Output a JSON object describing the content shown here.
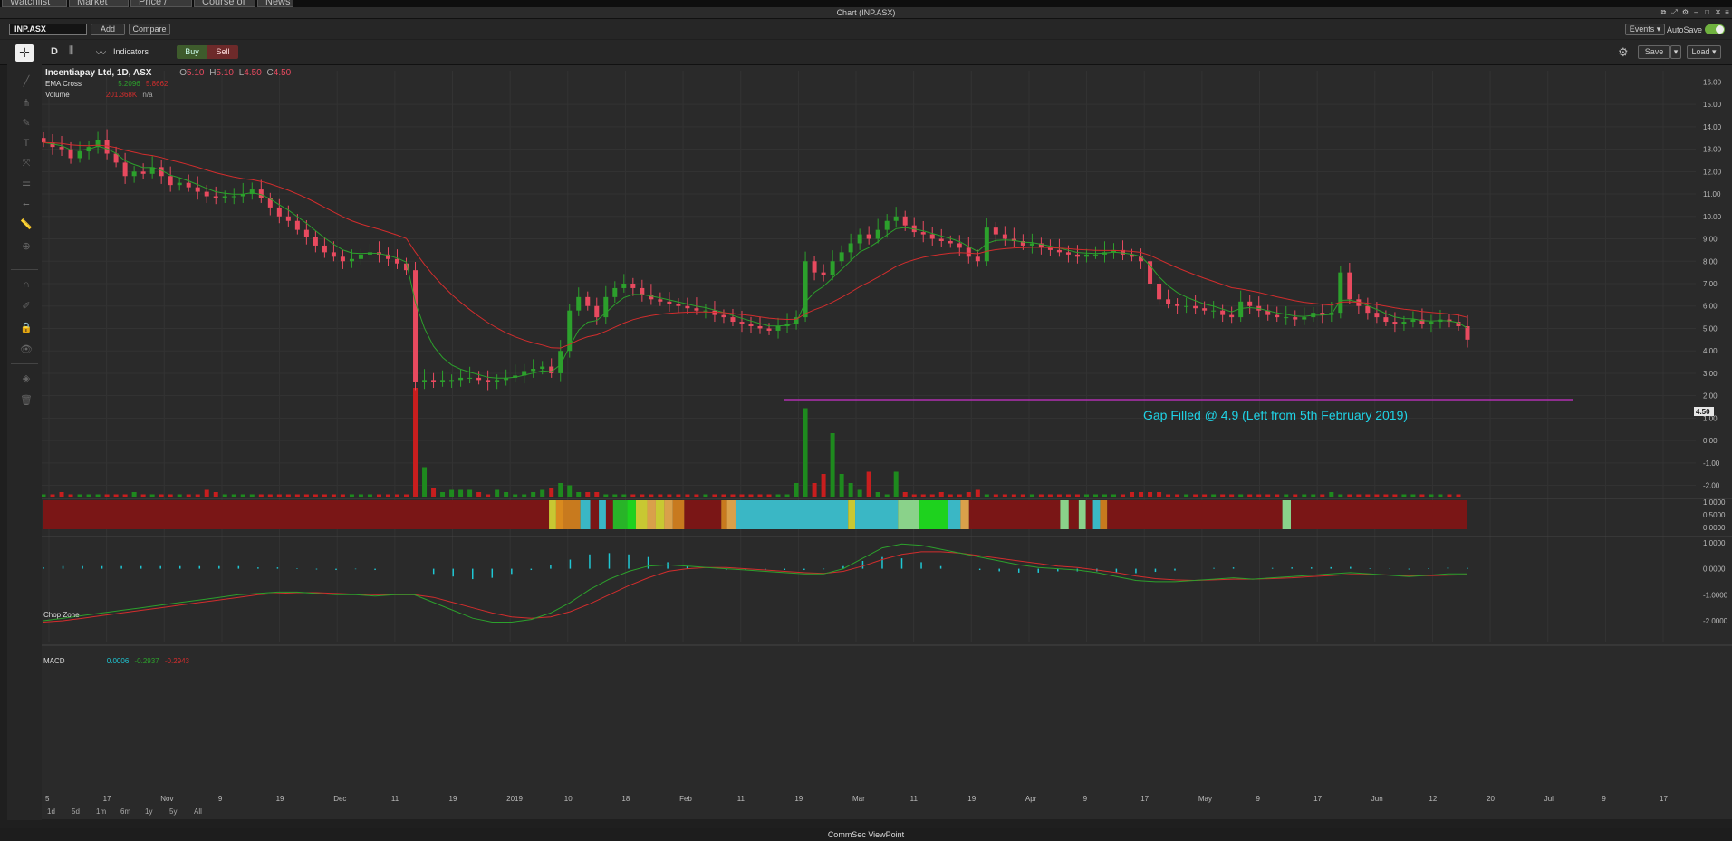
{
  "tabs": [
    "Watchlist",
    "Market Depth",
    "Price / Trade",
    "Course of Sales",
    "News"
  ],
  "window": {
    "title": "Chart (INP.ASX)"
  },
  "toolbar": {
    "symbol": "INP.ASX",
    "add": "Add",
    "compare": "Compare",
    "events": "Events",
    "autosave": "AutoSave",
    "interval": "D",
    "indicators": "Indicators",
    "buy": "Buy",
    "sell": "Sell",
    "save": "Save",
    "load": "Load"
  },
  "legend": {
    "name": "Incentiapay Ltd, 1D, ASX",
    "o_label": "O",
    "o": "5.10",
    "h_label": "H",
    "h": "5.10",
    "l_label": "L",
    "l": "4.50",
    "c_label": "C",
    "c": "4.50",
    "ema_label": "EMA Cross",
    "ema_fast": "5.2096",
    "ema_slow": "5.8662",
    "vol_label": "Volume",
    "vol_value": "201.368K",
    "vol_na": "n/a",
    "chop_label": "Chop Zone",
    "macd_label": "MACD",
    "macd_hist": "0.0006",
    "macd_line": "-0.2937",
    "macd_signal": "-0.2943"
  },
  "annotation": "Gap Filled @ 4.9 (Left from 5th February 2019)",
  "last_price_tag": "4.50",
  "footer": "CommSec ViewPoint",
  "timeframes": [
    "1d",
    "5d",
    "1m",
    "6m",
    "1y",
    "5y",
    "All"
  ],
  "colors": {
    "up": "#2ca02c",
    "down": "#e84a5f",
    "ema_fast": "#2ca02c",
    "ema_slow": "#d22d2d",
    "gap_line": "#b030b0",
    "annotation": "#1fd3e6",
    "macd_hist": "#1fc7d4"
  },
  "chart_data": [
    {
      "type": "candlestick",
      "title": "Incentiapay Ltd, 1D, ASX",
      "ylim": [
        -2.5,
        16.5
      ],
      "y_ticks": [
        "16.00",
        "15.00",
        "14.00",
        "13.00",
        "12.00",
        "11.00",
        "10.00",
        "9.00",
        "8.00",
        "7.00",
        "6.00",
        "5.00",
        "4.00",
        "3.00",
        "2.00",
        "1.00",
        "0.00",
        "-1.00",
        "-2.00"
      ],
      "x_ticks": [
        "5",
        "17",
        "Nov",
        "9",
        "19",
        "Dec",
        "11",
        "19",
        "2019",
        "10",
        "18",
        "Feb",
        "11",
        "19",
        "Mar",
        "11",
        "19",
        "Apr",
        "9",
        "17",
        "May",
        "9",
        "17",
        "Jun",
        "12",
        "20",
        "Jul",
        "9",
        "17"
      ],
      "close": [
        13.3,
        13.1,
        13.0,
        12.6,
        12.9,
        13.1,
        13.4,
        12.8,
        12.4,
        11.8,
        12.0,
        11.9,
        12.2,
        11.8,
        11.4,
        11.5,
        11.3,
        11.1,
        10.9,
        10.8,
        10.9,
        10.9,
        11.0,
        11.2,
        10.8,
        10.4,
        10.0,
        9.8,
        9.4,
        9.1,
        8.7,
        8.4,
        8.2,
        8.0,
        8.1,
        8.3,
        8.4,
        8.3,
        8.1,
        7.9,
        7.6,
        2.6,
        2.7,
        2.6,
        2.7,
        2.7,
        2.8,
        2.8,
        2.7,
        2.6,
        2.7,
        2.8,
        2.9,
        3.1,
        3.2,
        3.3,
        3.0,
        4.0,
        5.8,
        6.4,
        6.0,
        5.5,
        6.4,
        6.8,
        7.0,
        6.8,
        6.5,
        6.3,
        6.2,
        6.1,
        6.0,
        5.9,
        5.8,
        5.8,
        5.6,
        5.5,
        5.3,
        5.2,
        5.1,
        5.0,
        4.9,
        5.1,
        5.2,
        5.5,
        8.0,
        7.5,
        7.4,
        8.0,
        8.4,
        8.8,
        9.2,
        9.0,
        9.4,
        9.8,
        10.0,
        9.6,
        9.3,
        9.2,
        9.0,
        8.9,
        8.8,
        8.6,
        8.2,
        8.0,
        9.5,
        9.2,
        9.0,
        8.9,
        8.7,
        8.8,
        8.6,
        8.5,
        8.4,
        8.3,
        8.2,
        8.3,
        8.3,
        8.4,
        8.5,
        8.3,
        8.2,
        8.0,
        7.0,
        6.3,
        6.1,
        6.0,
        6.0,
        5.9,
        5.8,
        5.8,
        5.6,
        5.5,
        6.2,
        6.0,
        5.8,
        5.6,
        5.5,
        5.5,
        5.4,
        5.5,
        5.7,
        5.6,
        5.7,
        7.5,
        6.3,
        6.0,
        5.7,
        5.5,
        5.3,
        5.2,
        5.3,
        5.4,
        5.2,
        5.3,
        5.4,
        5.3,
        5.1,
        4.5
      ]
    },
    {
      "type": "bar",
      "title": "Volume",
      "values": [
        0.1,
        0.1,
        0.2,
        0.1,
        0.1,
        0.1,
        0.1,
        0.1,
        0.1,
        0.1,
        0.2,
        0.1,
        0.1,
        0.1,
        0.1,
        0.1,
        0.1,
        0.1,
        0.3,
        0.2,
        0.1,
        0.1,
        0.1,
        0.1,
        0.1,
        0.1,
        0.1,
        0.1,
        0.1,
        0.1,
        0.1,
        0.1,
        0.1,
        0.1,
        0.1,
        0.1,
        0.1,
        0.1,
        0.1,
        0.1,
        0.1,
        4.8,
        1.3,
        0.4,
        0.2,
        0.3,
        0.3,
        0.3,
        0.2,
        0.1,
        0.3,
        0.2,
        0.1,
        0.1,
        0.2,
        0.3,
        0.4,
        0.6,
        0.5,
        0.2,
        0.2,
        0.2,
        0.1,
        0.1,
        0.1,
        0.1,
        0.1,
        0.1,
        0.1,
        0.1,
        0.1,
        0.1,
        0.1,
        0.1,
        0.1,
        0.1,
        0.1,
        0.1,
        0.1,
        0.1,
        0.1,
        0.1,
        0.1,
        0.6,
        3.9,
        0.6,
        1.0,
        2.8,
        1.0,
        0.6,
        0.3,
        1.1,
        0.2,
        0.1,
        1.1,
        0.2,
        0.1,
        0.1,
        0.1,
        0.2,
        0.1,
        0.1,
        0.2,
        0.3,
        0.1,
        0.1,
        0.1,
        0.1,
        0.1,
        0.1,
        0.1,
        0.1,
        0.1,
        0.1,
        0.1,
        0.1,
        0.1,
        0.1,
        0.1,
        0.1,
        0.2,
        0.2,
        0.2,
        0.2,
        0.1,
        0.1,
        0.1,
        0.1,
        0.1,
        0.1,
        0.1,
        0.1,
        0.1,
        0.1,
        0.1,
        0.1,
        0.1,
        0.1,
        0.1,
        0.1,
        0.1,
        0.1,
        0.2,
        0.1,
        0.1,
        0.1,
        0.1,
        0.1,
        0.1,
        0.1,
        0.1,
        0.1,
        0.1,
        0.1,
        0.1,
        0.1,
        0.1
      ]
    },
    {
      "type": "heatmap",
      "title": "Chop Zone",
      "ylim": [
        0,
        1
      ],
      "y_ticks": [
        "1.0000",
        "0.5000",
        "0.0000"
      ],
      "zones": [
        {
          "from": 0,
          "to": 0.355,
          "color": "#7a1616"
        },
        {
          "from": 0.355,
          "to": 0.36,
          "color": "#c8c832"
        },
        {
          "from": 0.36,
          "to": 0.365,
          "color": "#d98a1e"
        },
        {
          "from": 0.365,
          "to": 0.377,
          "color": "#c87a1e"
        },
        {
          "from": 0.377,
          "to": 0.384,
          "color": "#3ab7c5"
        },
        {
          "from": 0.384,
          "to": 0.39,
          "color": "#7a1616"
        },
        {
          "from": 0.39,
          "to": 0.395,
          "color": "#3ab7c5"
        },
        {
          "from": 0.395,
          "to": 0.4,
          "color": "#7a1616"
        },
        {
          "from": 0.4,
          "to": 0.41,
          "color": "#28b428"
        },
        {
          "from": 0.41,
          "to": 0.416,
          "color": "#1ed21e"
        },
        {
          "from": 0.416,
          "to": 0.424,
          "color": "#c8c832"
        },
        {
          "from": 0.424,
          "to": 0.43,
          "color": "#d9a04a"
        },
        {
          "from": 0.43,
          "to": 0.436,
          "color": "#c8c832"
        },
        {
          "from": 0.436,
          "to": 0.442,
          "color": "#d9a04a"
        },
        {
          "from": 0.442,
          "to": 0.45,
          "color": "#c87a1e"
        },
        {
          "from": 0.45,
          "to": 0.476,
          "color": "#7a1616"
        },
        {
          "from": 0.476,
          "to": 0.48,
          "color": "#c87a1e"
        },
        {
          "from": 0.48,
          "to": 0.486,
          "color": "#d9a04a"
        },
        {
          "from": 0.486,
          "to": 0.565,
          "color": "#3ab7c5"
        },
        {
          "from": 0.565,
          "to": 0.57,
          "color": "#c8c832"
        },
        {
          "from": 0.57,
          "to": 0.6,
          "color": "#3ab7c5"
        },
        {
          "from": 0.6,
          "to": 0.615,
          "color": "#8ad28a"
        },
        {
          "from": 0.615,
          "to": 0.635,
          "color": "#1ed21e"
        },
        {
          "from": 0.635,
          "to": 0.644,
          "color": "#3ab7c5"
        },
        {
          "from": 0.644,
          "to": 0.65,
          "color": "#d9a04a"
        },
        {
          "from": 0.65,
          "to": 0.714,
          "color": "#7a1616"
        },
        {
          "from": 0.714,
          "to": 0.72,
          "color": "#8ad28a"
        },
        {
          "from": 0.72,
          "to": 0.727,
          "color": "#7a1616"
        },
        {
          "from": 0.727,
          "to": 0.732,
          "color": "#8ad28a"
        },
        {
          "from": 0.732,
          "to": 0.737,
          "color": "#7a1616"
        },
        {
          "from": 0.737,
          "to": 0.742,
          "color": "#3ab7c5"
        },
        {
          "from": 0.742,
          "to": 0.747,
          "color": "#c87a1e"
        },
        {
          "from": 0.747,
          "to": 0.87,
          "color": "#7a1616"
        },
        {
          "from": 0.87,
          "to": 0.876,
          "color": "#8ad28a"
        },
        {
          "from": 0.876,
          "to": 1,
          "color": "#7a1616"
        }
      ]
    },
    {
      "type": "line",
      "title": "MACD",
      "ylim": [
        -2.8,
        1.1
      ],
      "y_ticks": [
        "1.0000",
        "0.0000",
        "-1.0000",
        "-2.0000"
      ],
      "series": [
        {
          "name": "MACD",
          "values": [
            -2.0,
            -1.9,
            -1.8,
            -1.7,
            -1.6,
            -1.5,
            -1.4,
            -1.3,
            -1.2,
            -1.1,
            -1.0,
            -0.95,
            -0.9,
            -0.9,
            -0.95,
            -1.0,
            -1.0,
            -1.05,
            -1.0,
            -1.0,
            -1.3,
            -1.6,
            -1.9,
            -2.05,
            -2.05,
            -1.95,
            -1.7,
            -1.3,
            -0.8,
            -0.4,
            -0.1,
            0.1,
            0.15,
            0.1,
            0.05,
            0.0,
            -0.05,
            -0.1,
            -0.15,
            -0.2,
            -0.2,
            0.0,
            0.4,
            0.8,
            0.95,
            0.9,
            0.75,
            0.6,
            0.45,
            0.3,
            0.15,
            0.05,
            0.0,
            -0.05,
            -0.15,
            -0.3,
            -0.45,
            -0.5,
            -0.5,
            -0.45,
            -0.4,
            -0.35,
            -0.4,
            -0.35,
            -0.3,
            -0.25,
            -0.2,
            -0.15,
            -0.2,
            -0.25,
            -0.3,
            -0.25,
            -0.2,
            -0.2
          ]
        },
        {
          "name": "Signal",
          "values": [
            -2.05,
            -2.0,
            -1.9,
            -1.8,
            -1.7,
            -1.6,
            -1.5,
            -1.4,
            -1.3,
            -1.2,
            -1.1,
            -1.0,
            -0.95,
            -0.92,
            -0.92,
            -0.95,
            -0.98,
            -1.0,
            -1.0,
            -1.0,
            -1.1,
            -1.3,
            -1.5,
            -1.7,
            -1.85,
            -1.9,
            -1.85,
            -1.65,
            -1.35,
            -1.0,
            -0.65,
            -0.35,
            -0.1,
            0.0,
            0.05,
            0.05,
            0.0,
            -0.05,
            -0.1,
            -0.15,
            -0.18,
            -0.1,
            0.1,
            0.35,
            0.55,
            0.65,
            0.65,
            0.6,
            0.5,
            0.4,
            0.3,
            0.2,
            0.1,
            0.05,
            -0.05,
            -0.15,
            -0.28,
            -0.38,
            -0.43,
            -0.45,
            -0.43,
            -0.4,
            -0.4,
            -0.38,
            -0.35,
            -0.3,
            -0.26,
            -0.22,
            -0.22,
            -0.24,
            -0.27,
            -0.27,
            -0.25,
            -0.23
          ]
        },
        {
          "name": "Histogram",
          "values": [
            0.05,
            0.1,
            0.1,
            0.1,
            0.1,
            0.1,
            0.1,
            0.1,
            0.1,
            0.1,
            0.1,
            0.05,
            0.05,
            0.02,
            -0.03,
            -0.05,
            -0.02,
            -0.05,
            0.0,
            0.0,
            -0.2,
            -0.3,
            -0.4,
            -0.35,
            -0.2,
            -0.05,
            0.15,
            0.35,
            0.55,
            0.6,
            0.55,
            0.45,
            0.25,
            0.1,
            0.0,
            -0.05,
            -0.05,
            -0.05,
            -0.05,
            -0.05,
            -0.02,
            0.1,
            0.3,
            0.45,
            0.4,
            0.25,
            0.1,
            0.0,
            -0.05,
            -0.1,
            -0.15,
            -0.15,
            -0.1,
            -0.1,
            -0.1,
            -0.15,
            -0.17,
            -0.12,
            -0.07,
            0.0,
            0.03,
            0.05,
            0.0,
            0.03,
            0.05,
            0.05,
            0.06,
            0.07,
            0.02,
            -0.01,
            -0.03,
            0.02,
            0.05,
            0.03
          ]
        }
      ]
    }
  ]
}
